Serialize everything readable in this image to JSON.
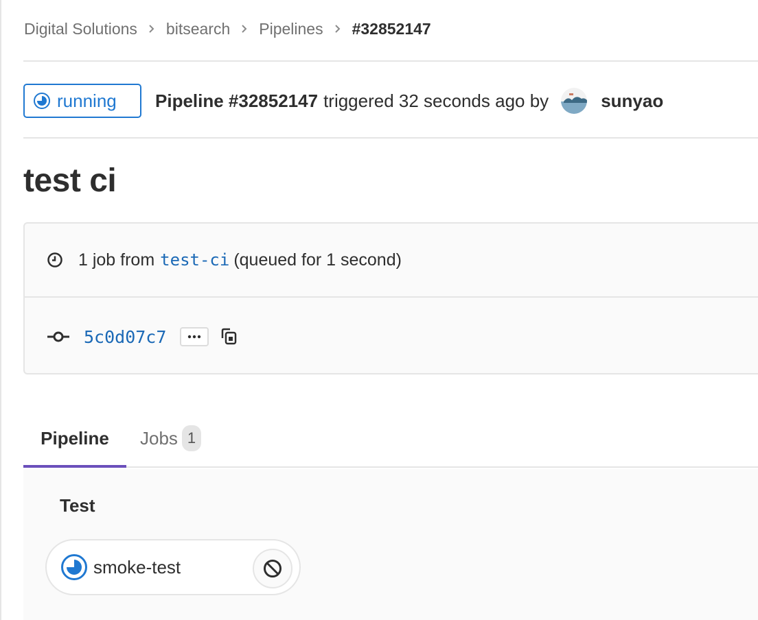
{
  "breadcrumb": {
    "items": [
      "Digital Solutions",
      "bitsearch",
      "Pipelines"
    ],
    "current": "#32852147"
  },
  "header": {
    "status": "running",
    "pipeline_label": "Pipeline #32852147",
    "triggered_text": "triggered 32 seconds ago by",
    "author": "sunyao"
  },
  "title": "test ci",
  "info": {
    "job_count_text": "1 job from",
    "ref": "test-ci",
    "queued_text": "(queued for 1 second)",
    "commit_sha": "5c0d07c7"
  },
  "tabs": {
    "pipeline": "Pipeline",
    "jobs": "Jobs",
    "jobs_count": "1"
  },
  "graph": {
    "stage": "Test",
    "job": "smoke-test"
  },
  "icons": {
    "status": "status-running-icon",
    "clock": "clock-icon",
    "commit": "commit-icon",
    "ellipsis": "ellipsis-icon",
    "copy": "copy-icon",
    "cancel": "cancel-icon"
  },
  "colors": {
    "running": "#1f78d1",
    "link": "#1b69b6",
    "tab_active": "#6b4fbb"
  }
}
